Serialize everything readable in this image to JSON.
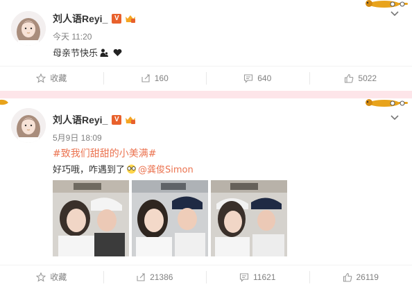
{
  "posts": [
    {
      "username": "刘人语Reyi_",
      "vip_mark": "V",
      "time": "今天 11:20",
      "text": "母亲节快乐",
      "actions": {
        "fav": "收藏",
        "repost": "160",
        "comment": "640",
        "like": "5022"
      }
    },
    {
      "username": "刘人语Reyi_",
      "vip_mark": "V",
      "time": "5月9日 18:09",
      "topic": "#致我们甜甜的小美满#",
      "text": "好巧哦，咋遇到了",
      "mention": "@龚俊Simon",
      "actions": {
        "fav": "收藏",
        "repost": "21386",
        "comment": "11621",
        "like": "26119"
      }
    }
  ],
  "colors": {
    "accent": "#eb7350",
    "separator": "#f4c8cf",
    "text_gray": "#808080"
  },
  "icons": [
    "star-icon",
    "repost-icon",
    "comment-icon",
    "like-icon",
    "chevron-down-icon",
    "dachshund-decoration-icon"
  ]
}
